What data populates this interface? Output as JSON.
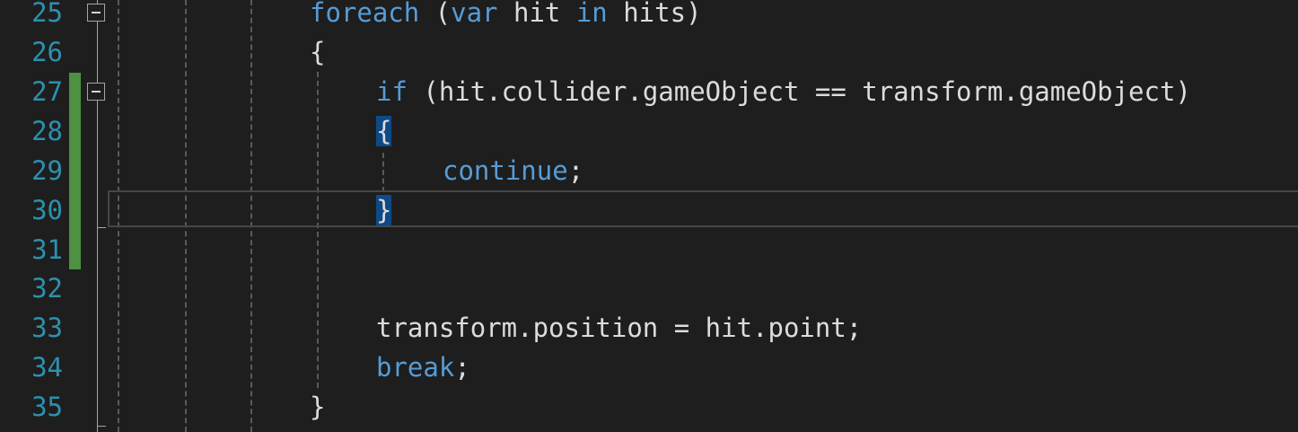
{
  "editor": {
    "line_numbers": [
      "25",
      "26",
      "27",
      "28",
      "29",
      "30",
      "31",
      "32",
      "33",
      "34",
      "35"
    ],
    "lines": {
      "l25": {
        "kw1": "foreach",
        "p1": " (",
        "kw2": "var",
        "p2": " hit ",
        "kw3": "in",
        "p3": " hits)"
      },
      "l26": {
        "p1": "{"
      },
      "l27": {
        "kw1": "if",
        "p1": " (hit.collider.gameObject == transform.gameObject)"
      },
      "l28": {
        "brace": "{"
      },
      "l29": {
        "kw1": "continue",
        "p1": ";"
      },
      "l30": {
        "brace": "}"
      },
      "l33": {
        "p1": "transform.position = hit.point;"
      },
      "l34": {
        "kw1": "break",
        "p1": ";"
      },
      "l35": {
        "p1": "}"
      }
    },
    "colors": {
      "background": "#1e1e1e",
      "keyword": "#569cd6",
      "line_number": "#2b91af",
      "change_bar": "#57a64a",
      "brace_highlight": "#0e4a86"
    }
  }
}
